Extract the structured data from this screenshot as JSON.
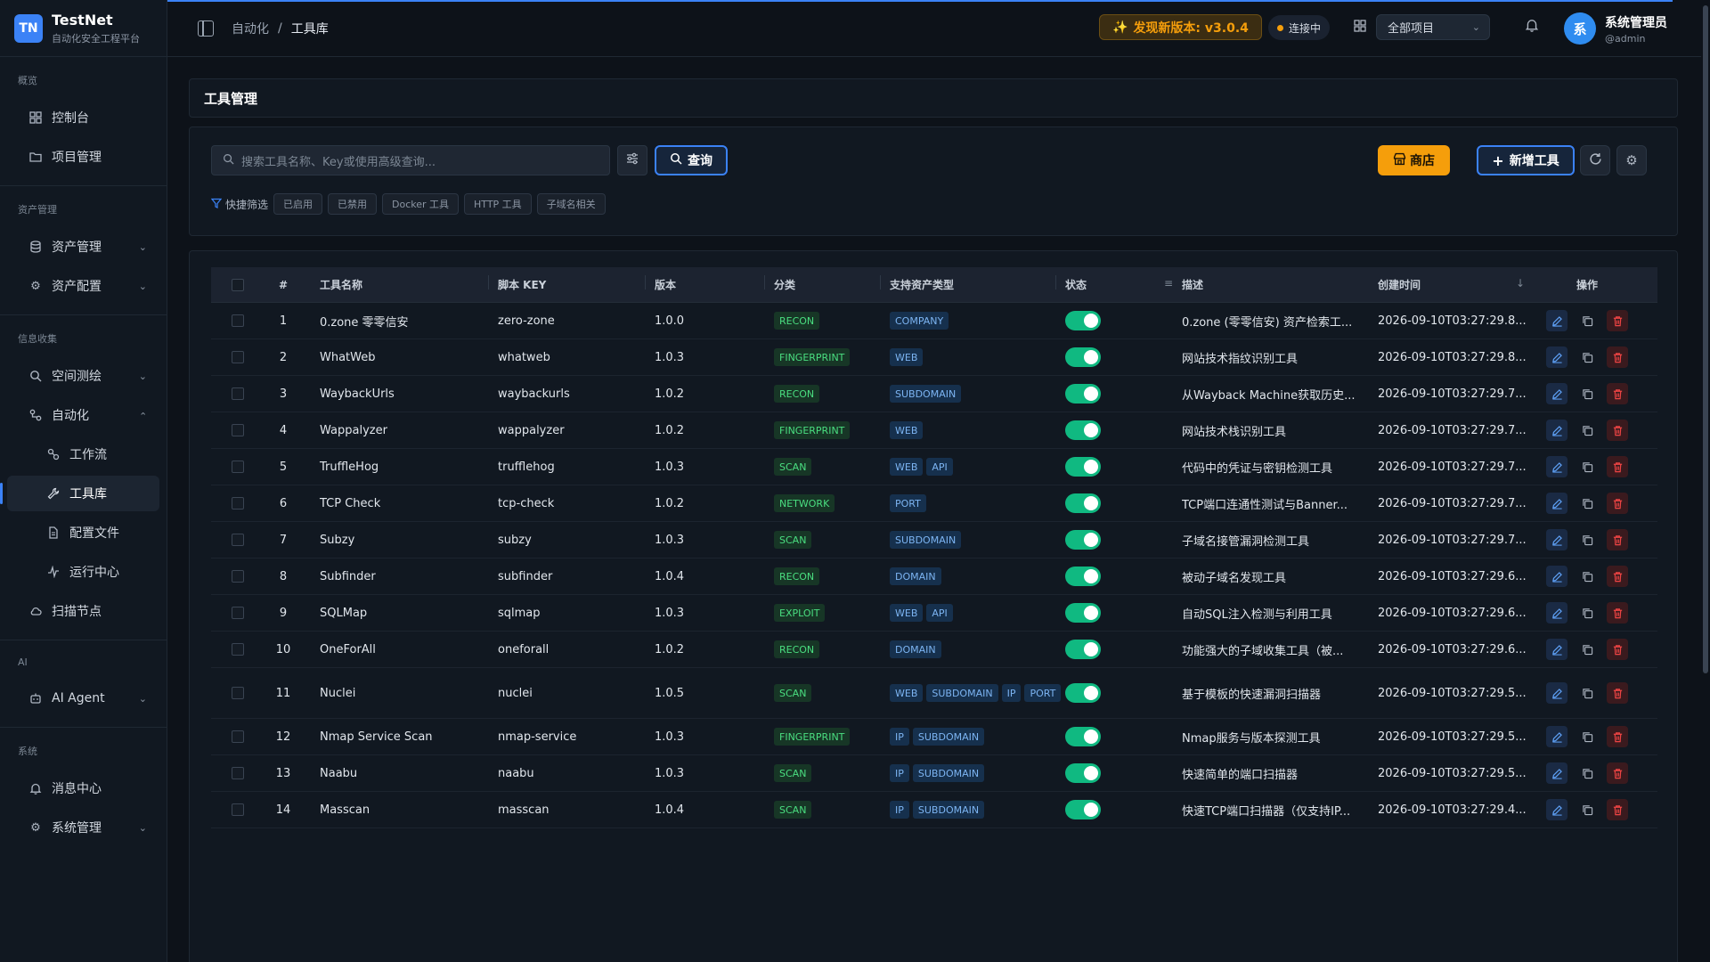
{
  "app": {
    "logo": "TN",
    "name": "TestNet",
    "subtitle": "自动化安全工程平台"
  },
  "sidebar": {
    "groups": [
      {
        "heading": "概览",
        "items": [
          {
            "label": "控制台",
            "icon": "dashboard-icon"
          },
          {
            "label": "项目管理",
            "icon": "folder-icon"
          }
        ]
      },
      {
        "heading": "资产管理",
        "items": [
          {
            "label": "资产管理",
            "icon": "database-icon"
          },
          {
            "label": "资产配置",
            "icon": "gear-icon"
          }
        ]
      },
      {
        "heading": "信息收集",
        "items": [
          {
            "label": "空间测绘",
            "icon": "search-icon"
          },
          {
            "label": "自动化",
            "icon": "workflow-icon"
          },
          {
            "label": "工作流",
            "icon": "flow-icon"
          },
          {
            "label": "工具库",
            "icon": "wrench-icon"
          },
          {
            "label": "配置文件",
            "icon": "file-icon"
          },
          {
            "label": "运行中心",
            "icon": "activity-icon"
          },
          {
            "label": "扫描节点",
            "icon": "cloud-icon"
          }
        ]
      },
      {
        "heading": "AI",
        "items": [
          {
            "label": "AI Agent",
            "icon": "bot-icon"
          }
        ]
      },
      {
        "heading": "系统",
        "items": [
          {
            "label": "消息中心",
            "icon": "bell-icon"
          },
          {
            "label": "系统管理",
            "icon": "gear-icon"
          }
        ]
      }
    ]
  },
  "header": {
    "breadcrumb": [
      "自动化",
      "工具库"
    ],
    "update_badge": "发现新版本: v3.0.4",
    "connection": "连接中",
    "project_select": "全部项目",
    "user_name": "系统管理员",
    "user_handle": "@admin",
    "avatar": "系"
  },
  "page": {
    "title": "工具管理"
  },
  "toolbar": {
    "search_placeholder": "搜索工具名称、Key或使用高级查询...",
    "query_label": "查询",
    "shop_label": "商店",
    "add_label": "新增工具",
    "quick_filter_label": "快捷筛选",
    "quick_filters": [
      "已启用",
      "已禁用",
      "Docker 工具",
      "HTTP 工具",
      "子域名相关"
    ]
  },
  "table": {
    "columns": [
      "#",
      "工具名称",
      "脚本 KEY",
      "版本",
      "分类",
      "支持资产类型",
      "状态",
      "描述",
      "创建时间",
      "操作"
    ],
    "rows": [
      {
        "idx": "1",
        "name": "0.zone 零零信安",
        "key": "zero-zone",
        "version": "1.0.0",
        "category": "RECON",
        "assets": [
          "COMPANY"
        ],
        "desc": "0.zone (零零信安) 资产检索工...",
        "time": "2026-09-10T03:27:29.8..."
      },
      {
        "idx": "2",
        "name": "WhatWeb",
        "key": "whatweb",
        "version": "1.0.3",
        "category": "FINGERPRINT",
        "assets": [
          "WEB"
        ],
        "desc": "网站技术指纹识别工具",
        "time": "2026-09-10T03:27:29.8..."
      },
      {
        "idx": "3",
        "name": "WaybackUrls",
        "key": "waybackurls",
        "version": "1.0.2",
        "category": "RECON",
        "assets": [
          "SUBDOMAIN"
        ],
        "desc": "从Wayback Machine获取历史...",
        "time": "2026-09-10T03:27:29.7..."
      },
      {
        "idx": "4",
        "name": "Wappalyzer",
        "key": "wappalyzer",
        "version": "1.0.2",
        "category": "FINGERPRINT",
        "assets": [
          "WEB"
        ],
        "desc": "网站技术栈识别工具",
        "time": "2026-09-10T03:27:29.7..."
      },
      {
        "idx": "5",
        "name": "TruffleHog",
        "key": "trufflehog",
        "version": "1.0.3",
        "category": "SCAN",
        "assets": [
          "WEB",
          "API"
        ],
        "desc": "代码中的凭证与密钥检测工具",
        "time": "2026-09-10T03:27:29.7..."
      },
      {
        "idx": "6",
        "name": "TCP Check",
        "key": "tcp-check",
        "version": "1.0.2",
        "category": "NETWORK",
        "assets": [
          "PORT"
        ],
        "desc": "TCP端口连通性测试与Banner...",
        "time": "2026-09-10T03:27:29.7..."
      },
      {
        "idx": "7",
        "name": "Subzy",
        "key": "subzy",
        "version": "1.0.3",
        "category": "SCAN",
        "assets": [
          "SUBDOMAIN"
        ],
        "desc": "子域名接管漏洞检测工具",
        "time": "2026-09-10T03:27:29.7..."
      },
      {
        "idx": "8",
        "name": "Subfinder",
        "key": "subfinder",
        "version": "1.0.4",
        "category": "RECON",
        "assets": [
          "DOMAIN"
        ],
        "desc": "被动子域名发现工具",
        "time": "2026-09-10T03:27:29.6..."
      },
      {
        "idx": "9",
        "name": "SQLMap",
        "key": "sqlmap",
        "version": "1.0.3",
        "category": "EXPLOIT",
        "assets": [
          "WEB",
          "API"
        ],
        "desc": "自动SQL注入检测与利用工具",
        "time": "2026-09-10T03:27:29.6..."
      },
      {
        "idx": "10",
        "name": "OneForAll",
        "key": "oneforall",
        "version": "1.0.2",
        "category": "RECON",
        "assets": [
          "DOMAIN"
        ],
        "desc": "功能强大的子域收集工具（被...",
        "time": "2026-09-10T03:27:29.6..."
      },
      {
        "idx": "11",
        "name": "Nuclei",
        "key": "nuclei",
        "version": "1.0.5",
        "category": "SCAN",
        "assets": [
          "WEB",
          "SUBDOMAIN",
          "IP",
          "PORT"
        ],
        "desc": "基于模板的快速漏洞扫描器",
        "time": "2026-09-10T03:27:29.5..."
      },
      {
        "idx": "12",
        "name": "Nmap Service Scan",
        "key": "nmap-service",
        "version": "1.0.3",
        "category": "FINGERPRINT",
        "assets": [
          "IP",
          "SUBDOMAIN"
        ],
        "desc": "Nmap服务与版本探测工具",
        "time": "2026-09-10T03:27:29.5..."
      },
      {
        "idx": "13",
        "name": "Naabu",
        "key": "naabu",
        "version": "1.0.3",
        "category": "SCAN",
        "assets": [
          "IP",
          "SUBDOMAIN"
        ],
        "desc": "快速简单的端口扫描器",
        "time": "2026-09-10T03:27:29.5..."
      },
      {
        "idx": "14",
        "name": "Masscan",
        "key": "masscan",
        "version": "1.0.4",
        "category": "SCAN",
        "assets": [
          "IP",
          "SUBDOMAIN"
        ],
        "desc": "快速TCP端口扫描器（仅支持IP...",
        "time": "2026-09-10T03:27:29.4..."
      }
    ]
  },
  "colors": {
    "accent": "#3b82f6",
    "warning": "#f59e0b",
    "success": "#10b981",
    "danger": "#ef4444"
  }
}
